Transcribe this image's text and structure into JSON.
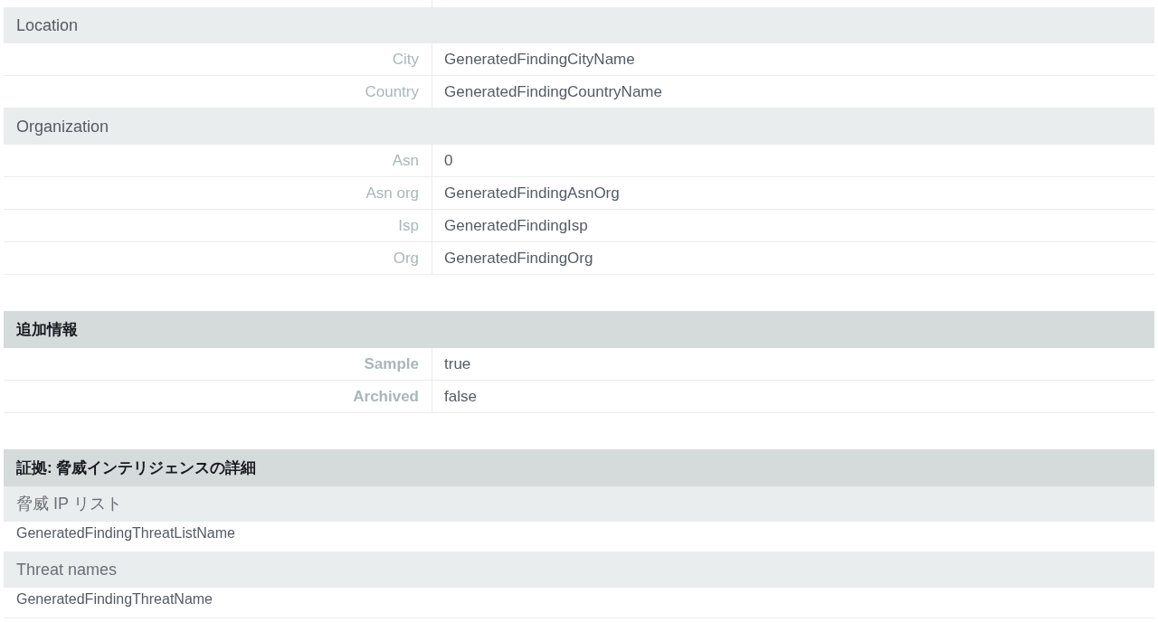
{
  "blocks": [
    {
      "kind": "group",
      "title": "Location",
      "rows": [
        {
          "label": "City",
          "value": "GeneratedFindingCityName"
        },
        {
          "label": "Country",
          "value": "GeneratedFindingCountryName"
        }
      ]
    },
    {
      "kind": "group",
      "title": "Organization",
      "rows": [
        {
          "label": "Asn",
          "value": "0"
        },
        {
          "label": "Asn org",
          "value": "GeneratedFindingAsnOrg"
        },
        {
          "label": "Isp",
          "value": "GeneratedFindingIsp"
        },
        {
          "label": "Org",
          "value": "GeneratedFindingOrg"
        }
      ]
    },
    {
      "kind": "section",
      "title": "追加情報",
      "rows": [
        {
          "label": "Sample",
          "value": "true"
        },
        {
          "label": "Archived",
          "value": "false"
        }
      ]
    },
    {
      "kind": "section",
      "title": "証拠: 脅威インテリジェンスの詳細",
      "lists": [
        {
          "title": "脅威 IP リスト",
          "items": [
            "GeneratedFindingThreatListName"
          ]
        },
        {
          "title": "Threat names",
          "items": [
            "GeneratedFindingThreatName"
          ]
        }
      ]
    }
  ]
}
